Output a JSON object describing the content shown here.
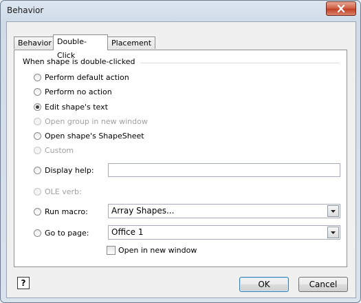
{
  "window": {
    "title": "Behavior",
    "close_icon": "close-icon"
  },
  "tabs": [
    {
      "label": "Behavior",
      "active": false
    },
    {
      "label": "Double-Click",
      "active": true
    },
    {
      "label": "Placement",
      "active": false
    }
  ],
  "group": {
    "title": "When shape is double-clicked"
  },
  "options": [
    {
      "label": "Perform default action",
      "checked": false,
      "enabled": true
    },
    {
      "label": "Perform no action",
      "checked": false,
      "enabled": true
    },
    {
      "label": "Edit shape's text",
      "checked": true,
      "enabled": true
    },
    {
      "label": "Open group in new window",
      "checked": false,
      "enabled": false
    },
    {
      "label": "Open shape's ShapeSheet",
      "checked": false,
      "enabled": true
    },
    {
      "label": "Custom",
      "checked": false,
      "enabled": false
    },
    {
      "label": "Display help:",
      "checked": false,
      "enabled": true
    },
    {
      "label": "OLE verb:",
      "checked": false,
      "enabled": false
    },
    {
      "label": "Run macro:",
      "checked": false,
      "enabled": true
    },
    {
      "label": "Go to page:",
      "checked": false,
      "enabled": true
    }
  ],
  "fields": {
    "display_help_value": "",
    "run_macro_value": "Array Shapes...",
    "go_to_page_value": "Office 1"
  },
  "open_new_window": {
    "label": "Open in new window",
    "checked": false
  },
  "buttons": {
    "help": "?",
    "ok": "OK",
    "cancel": "Cancel"
  }
}
